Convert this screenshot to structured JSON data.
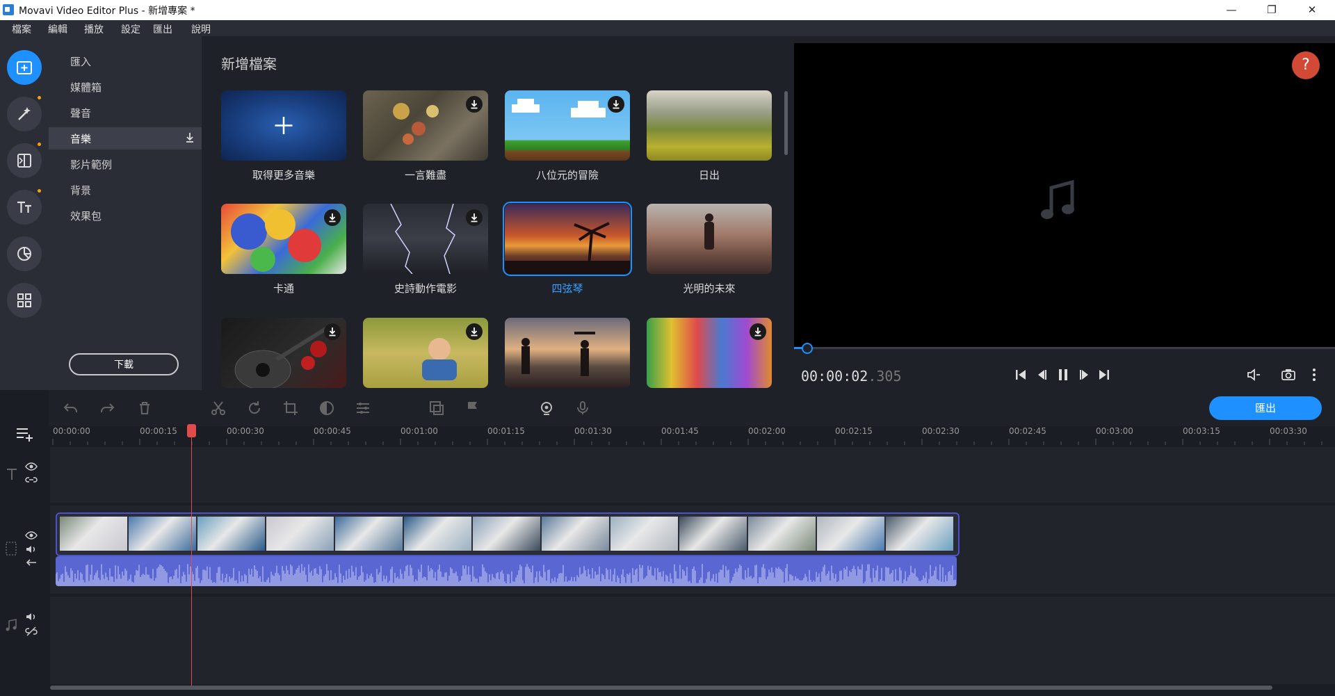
{
  "window": {
    "title": "Movavi Video Editor Plus - 新增專案 *",
    "minimize": "—",
    "restore": "❐",
    "close": "✕"
  },
  "menu": [
    "檔案",
    "編輯",
    "播放",
    "設定",
    "匯出",
    "說明"
  ],
  "rail": [
    {
      "icon": "import-icon",
      "active": true
    },
    {
      "icon": "magic-wand-icon",
      "dot": true
    },
    {
      "icon": "transition-icon",
      "dot": true
    },
    {
      "icon": "titles-icon",
      "dot": true
    },
    {
      "icon": "sticker-icon"
    },
    {
      "icon": "more-tools-icon"
    }
  ],
  "categories": [
    "匯入",
    "媒體箱",
    "聲音",
    "音樂",
    "影片範例",
    "背景",
    "效果包"
  ],
  "active_category": "音樂",
  "download_button": "下載",
  "content": {
    "heading": "新增檔案",
    "tiles": [
      {
        "label": "取得更多音樂"
      },
      {
        "label": "一言難盡"
      },
      {
        "label": "八位元的冒險"
      },
      {
        "label": "日出"
      },
      {
        "label": "卡通"
      },
      {
        "label": "史詩動作電影"
      },
      {
        "label": "四弦琴",
        "selected": true
      },
      {
        "label": "光明的未來"
      },
      {
        "label": ""
      },
      {
        "label": ""
      },
      {
        "label": ""
      },
      {
        "label": ""
      }
    ]
  },
  "player": {
    "help": "?",
    "time_main": "00:00:02",
    "time_ms": ".305",
    "progress": 0.02
  },
  "export_button": "匯出",
  "ruler_ticks": [
    "00:00:00",
    "00:00:15",
    "00:00:30",
    "00:00:45",
    "00:01:00",
    "00:01:15",
    "00:01:30",
    "00:01:45",
    "00:02:00",
    "00:02:15",
    "00:02:30",
    "00:02:45",
    "00:03:00",
    "00:03:15",
    "00:03:30"
  ],
  "colors": {
    "accent": "#1e90ff",
    "playhead": "#e04b4b",
    "help": "#d24a36",
    "notify_dot": "#f2a20c"
  }
}
